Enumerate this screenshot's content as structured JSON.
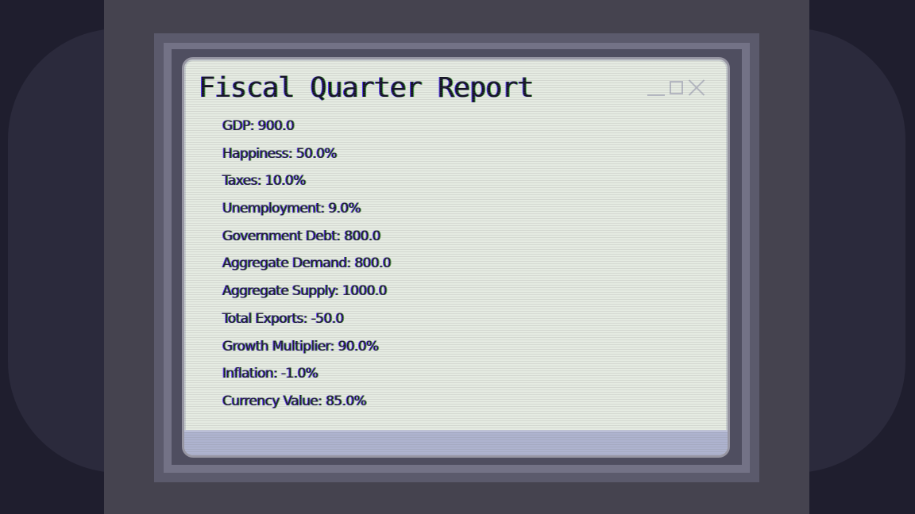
{
  "window": {
    "title": "Fiscal Quarter Report",
    "controls": {
      "minimize_icon": "minimize-icon",
      "maximize_icon": "maximize-icon",
      "close_icon": "close-icon"
    }
  },
  "stats": [
    "GDP: 900.0",
    "Happiness: 50.0%",
    "Taxes: 10.0%",
    "Unemployment: 9.0%",
    "Government Debt: 800.0",
    "Aggregate Demand: 800.0",
    "Aggregate Supply: 1000.0",
    "Total Exports: -50.0",
    "Growth Multiplier: 90.0%",
    "Inflation: -1.0%",
    "Currency Value: 85.0%"
  ],
  "colors": {
    "background": "#1f1e2e",
    "panel": "#45434f",
    "window_body": "#e5ebe2",
    "window_footer": "#aeb3cf",
    "text": "#151423"
  }
}
